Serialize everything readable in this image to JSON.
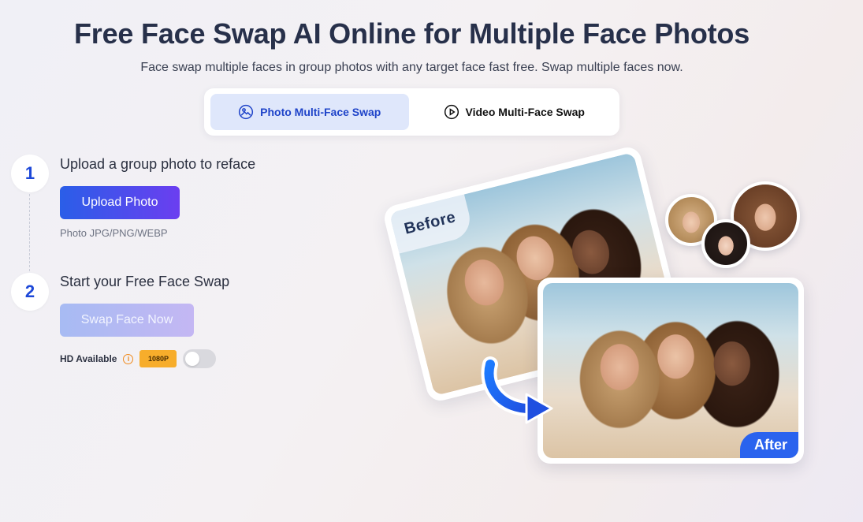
{
  "header": {
    "title": "Free Face Swap AI Online for Multiple Face Photos",
    "subtitle": "Face swap multiple faces in group photos with any target face fast free. Swap multiple faces now."
  },
  "tabs": [
    {
      "label": "Photo Multi-Face Swap",
      "icon": "image-icon",
      "active": true
    },
    {
      "label": "Video Multi-Face Swap",
      "icon": "play-circle-icon",
      "active": false
    }
  ],
  "steps": [
    {
      "number": "1",
      "label": "Upload a group photo to reface"
    },
    {
      "number": "2",
      "label": "Start your Free Face Swap"
    }
  ],
  "upload": {
    "button_label": "Upload Photo",
    "formats": "Photo JPG/PNG/WEBP"
  },
  "swap": {
    "button_label": "Swap Face Now",
    "enabled": false
  },
  "hd": {
    "label": "HD Available",
    "badge": "1080P",
    "toggle_on": false
  },
  "illustration": {
    "before_label": "Before",
    "after_label": "After"
  },
  "colors": {
    "accent_blue": "#1f44c9",
    "upload_gradient_start": "#2a5ee8",
    "upload_gradient_end": "#6b3ef0",
    "badge_bg": "#f7ad2b",
    "after_tag_bg": "#2a63ee"
  }
}
